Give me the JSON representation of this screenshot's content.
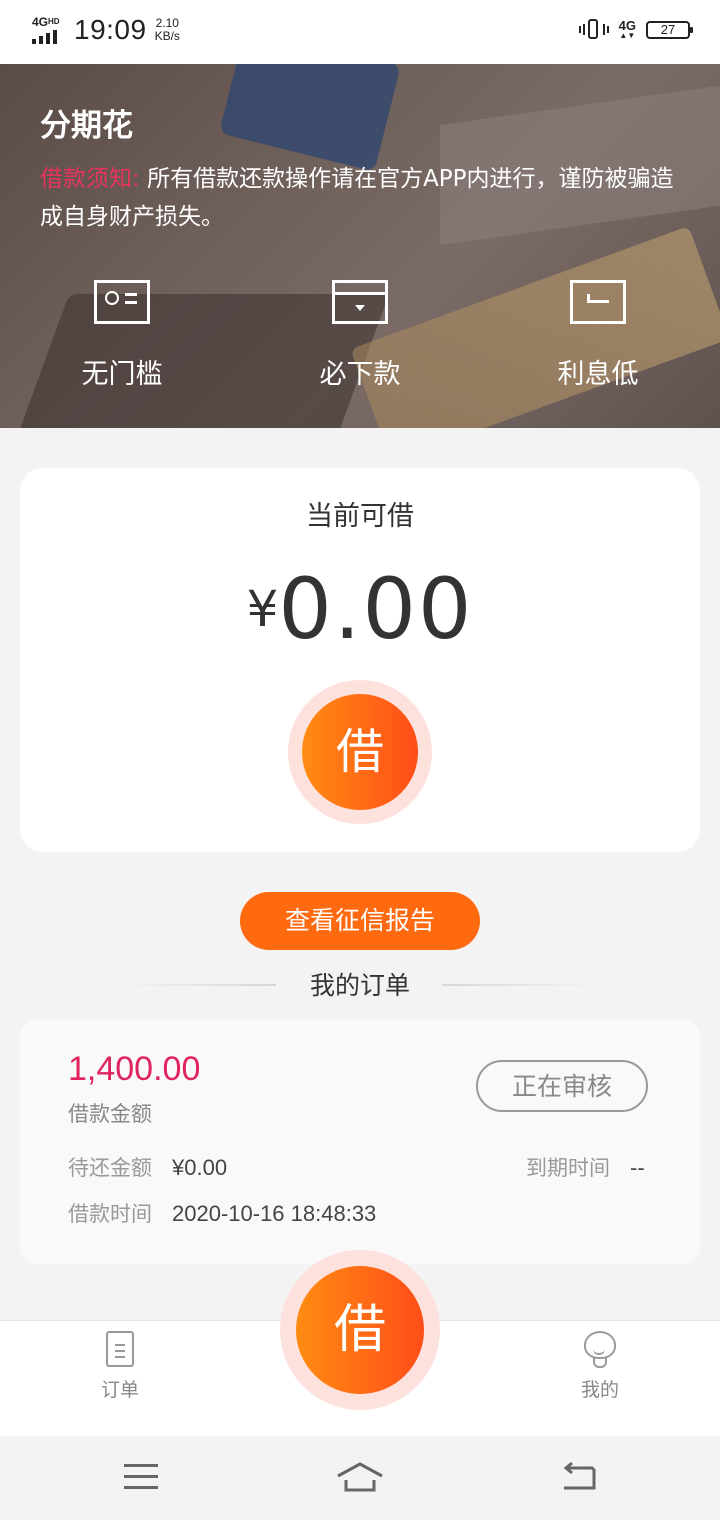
{
  "status_bar": {
    "network": "4G",
    "network_sup": "HD",
    "time": "19:09",
    "speed_value": "2.10",
    "speed_unit": "KB/s",
    "network_right": "4G",
    "battery": "27"
  },
  "banner": {
    "title": "分期花",
    "notice_label": "借款须知:",
    "notice_text": "所有借款还款操作请在官方APP内进行，谨防被骗造成自身财产损失。",
    "features": [
      {
        "label": "无门槛",
        "icon": "id-card-icon"
      },
      {
        "label": "必下款",
        "icon": "wallet-icon"
      },
      {
        "label": "利息低",
        "icon": "return-card-icon"
      }
    ]
  },
  "loan_card": {
    "title": "当前可借",
    "currency": "¥",
    "amount": "0.00",
    "borrow_label": "借"
  },
  "credit_button": "查看征信报告",
  "orders": {
    "heading": "我的订单",
    "items": [
      {
        "amount": "1,400.00",
        "amount_label": "借款金额",
        "status": "正在审核",
        "pending_label": "待还金额",
        "pending_value": "¥0.00",
        "due_label": "到期时间",
        "due_value": "--",
        "loan_time_label": "借款时间",
        "loan_time_value": "2020-10-16 18:48:33"
      }
    ]
  },
  "tabbar": {
    "orders_label": "订单",
    "borrow_label": "借",
    "mine_label": "我的"
  },
  "colors": {
    "accent": "#ff6a10",
    "amount_red": "#e0245e",
    "notice_red": "#e8345c"
  }
}
